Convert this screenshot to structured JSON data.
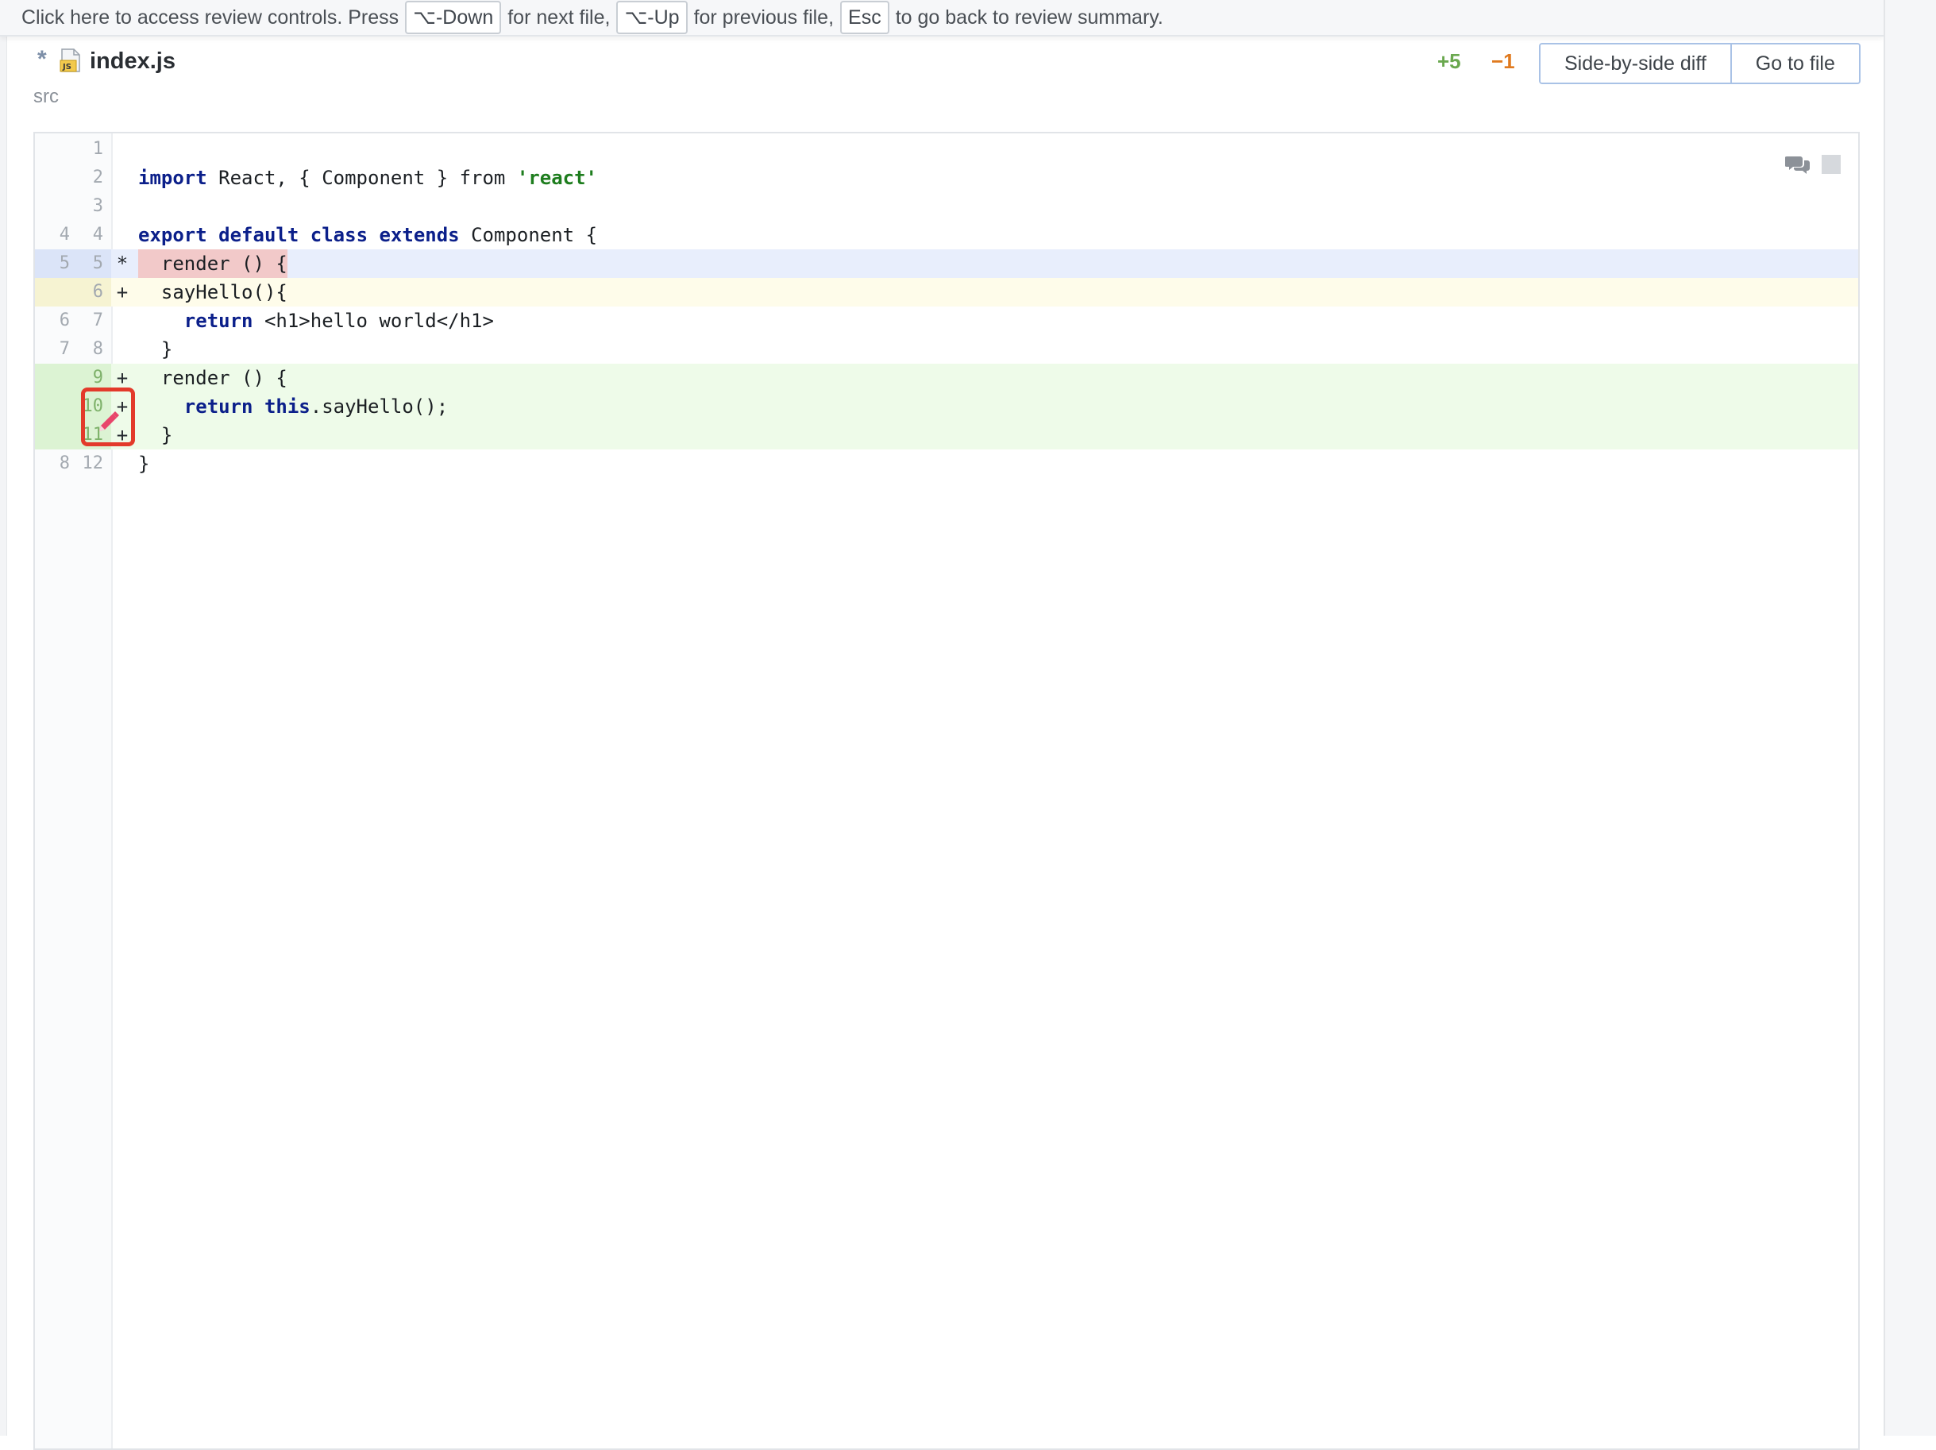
{
  "hint": {
    "prefix": "Click here to access review controls. Press",
    "key_next": "⌥-Down",
    "text_next": "for next file,",
    "key_prev": "⌥-Up",
    "text_prev": "for previous file,",
    "key_esc": "Esc",
    "text_esc": "to go back to review summary."
  },
  "file": {
    "modified_marker": "*",
    "icon": "js-file-icon",
    "name": "index.js",
    "path": "src",
    "additions": "+5",
    "deletions": "−1"
  },
  "buttons": {
    "side_by_side": "Side-by-side diff",
    "go_to_file": "Go to file"
  },
  "diff_lines": [
    {
      "old": "",
      "new": "1",
      "marker": "",
      "type": "context"
    },
    {
      "old": "",
      "new": "2",
      "marker": "",
      "type": "context"
    },
    {
      "old": "",
      "new": "3",
      "marker": "",
      "type": "context"
    },
    {
      "old": "4",
      "new": "4",
      "marker": "",
      "type": "context"
    },
    {
      "old": "5",
      "new": "5",
      "marker": "*",
      "type": "modified"
    },
    {
      "old": "",
      "new": "6",
      "marker": "+",
      "type": "changed"
    },
    {
      "old": "6",
      "new": "7",
      "marker": "",
      "type": "context"
    },
    {
      "old": "7",
      "new": "8",
      "marker": "",
      "type": "context"
    },
    {
      "old": "",
      "new": "9",
      "marker": "+",
      "type": "added"
    },
    {
      "old": "",
      "new": "10",
      "marker": "+",
      "type": "added"
    },
    {
      "old": "",
      "new": "11",
      "marker": "+",
      "type": "added"
    },
    {
      "old": "8",
      "new": "12",
      "marker": "",
      "type": "context"
    }
  ],
  "code": {
    "l2_import": "import",
    "l2_rest": " React, { Component } from ",
    "l2_str": "'react'",
    "l4_export": "export",
    "l4_default": "default",
    "l4_class": "class",
    "l4_extends": "extends",
    "l4_rest": " Component {",
    "l5": "  render () {",
    "l6": "  sayHello(){",
    "l7_return": "return",
    "l7_rest": " <h1>hello world</h1>",
    "l8": "  }",
    "l9": "  render () {",
    "l10_return": "return",
    "l10_this": "this",
    "l10_rest": ".sayHello();",
    "l11": "  }",
    "l12": "}"
  },
  "icons": {
    "comments": "comments-icon",
    "toggle": "square-icon",
    "edit": "pencil-icon"
  },
  "colors": {
    "added_bg": "#eefbe9",
    "modified_bg": "#e8eefc",
    "changed_bg": "#fefcea",
    "deleted_highlight": "#f2c9c9",
    "highlight_box": "#e33a2b"
  }
}
